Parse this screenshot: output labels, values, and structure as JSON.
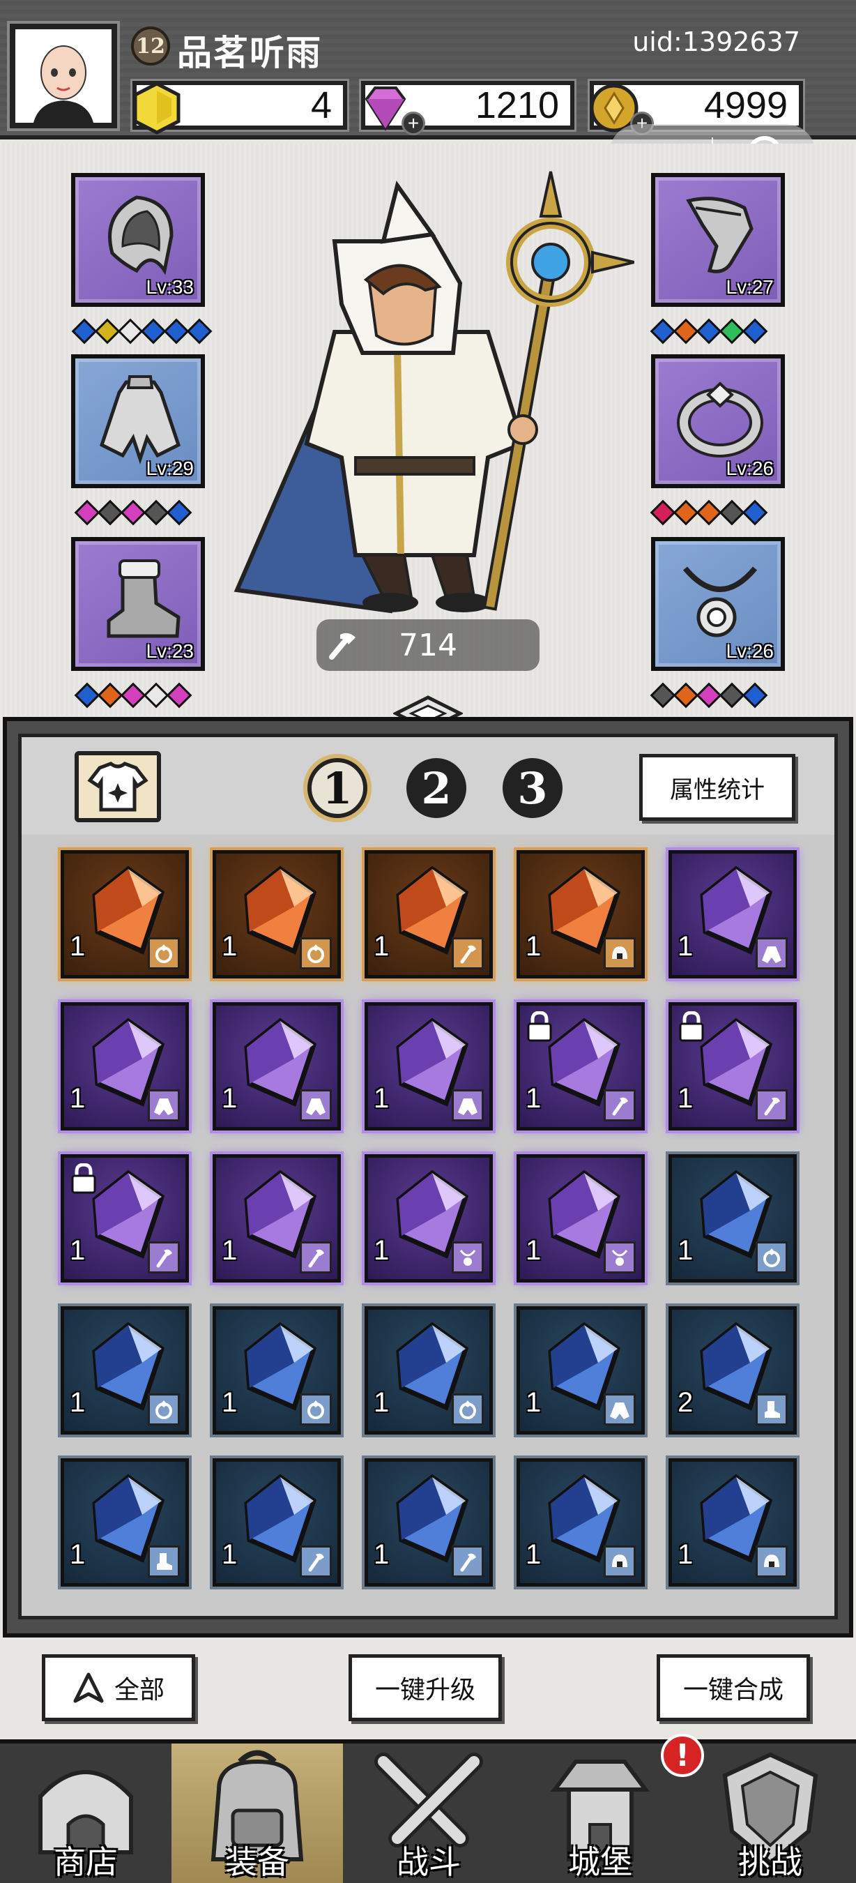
{
  "player": {
    "level": "12",
    "name": "品茗听雨",
    "uid": "uid:1392637"
  },
  "currencies": [
    {
      "name": "gold-gem",
      "value": "4"
    },
    {
      "name": "diamond",
      "value": "1210"
    },
    {
      "name": "coin",
      "value": "4999"
    }
  ],
  "hero": {
    "power": "714"
  },
  "equipment_left": [
    {
      "slot": "helmet",
      "level": "Lv:33",
      "rarity": "purple",
      "gems": [
        "#1f5fd0",
        "#d4b21a",
        "#e8e8e8",
        "#1f5fd0",
        "#1f5fd0",
        "#1f5fd0"
      ]
    },
    {
      "slot": "armor",
      "level": "Lv:29",
      "rarity": "blue",
      "gems": [
        "#d43fbe",
        "#555555",
        "#d43fbe",
        "#555555",
        "#1f5fd0"
      ]
    },
    {
      "slot": "boots",
      "level": "Lv:23",
      "rarity": "purple",
      "gems": [
        "#1f5fd0",
        "#e0651b",
        "#d43fbe",
        "#e8e8e8",
        "#d43fbe"
      ]
    }
  ],
  "equipment_right": [
    {
      "slot": "gloves",
      "level": "Lv:27",
      "rarity": "purple",
      "gems": [
        "#1f5fd0",
        "#e0651b",
        "#1f5fd0",
        "#2fbf5a",
        "#1f5fd0"
      ]
    },
    {
      "slot": "ring",
      "level": "Lv:26",
      "rarity": "purple",
      "gems": [
        "#d41f5a",
        "#e0651b",
        "#e0651b",
        "#555555",
        "#1f5fd0"
      ]
    },
    {
      "slot": "necklace",
      "level": "Lv:26",
      "rarity": "blue",
      "gems": [
        "#555555",
        "#e0651b",
        "#d43fbe",
        "#555555",
        "#1f5fd0"
      ]
    }
  ],
  "bag": {
    "tabs": [
      "1",
      "2",
      "3"
    ],
    "active_tab": "1",
    "stats_button": "属性统计",
    "items": [
      {
        "rarity": "orange",
        "count": "1",
        "type": "ring",
        "locked": false
      },
      {
        "rarity": "orange",
        "count": "1",
        "type": "ring",
        "locked": false
      },
      {
        "rarity": "orange",
        "count": "1",
        "type": "weapon",
        "locked": false
      },
      {
        "rarity": "orange",
        "count": "1",
        "type": "helmet",
        "locked": false
      },
      {
        "rarity": "purple",
        "count": "1",
        "type": "armor",
        "locked": false
      },
      {
        "rarity": "purple",
        "count": "1",
        "type": "armor",
        "locked": false
      },
      {
        "rarity": "purple",
        "count": "1",
        "type": "armor",
        "locked": false
      },
      {
        "rarity": "purple",
        "count": "1",
        "type": "armor",
        "locked": false
      },
      {
        "rarity": "purple",
        "count": "1",
        "type": "weapon",
        "locked": true
      },
      {
        "rarity": "purple",
        "count": "1",
        "type": "weapon",
        "locked": true
      },
      {
        "rarity": "purple",
        "count": "1",
        "type": "weapon",
        "locked": true
      },
      {
        "rarity": "purple",
        "count": "1",
        "type": "weapon",
        "locked": false
      },
      {
        "rarity": "purple",
        "count": "1",
        "type": "necklace",
        "locked": false
      },
      {
        "rarity": "purple",
        "count": "1",
        "type": "necklace",
        "locked": false
      },
      {
        "rarity": "blue",
        "count": "1",
        "type": "ring",
        "locked": false
      },
      {
        "rarity": "blue",
        "count": "1",
        "type": "ring",
        "locked": false
      },
      {
        "rarity": "blue",
        "count": "1",
        "type": "ring",
        "locked": false
      },
      {
        "rarity": "blue",
        "count": "1",
        "type": "ring",
        "locked": false
      },
      {
        "rarity": "blue",
        "count": "1",
        "type": "armor",
        "locked": false
      },
      {
        "rarity": "blue",
        "count": "2",
        "type": "boots",
        "locked": false
      },
      {
        "rarity": "blue",
        "count": "1",
        "type": "boots",
        "locked": false
      },
      {
        "rarity": "blue",
        "count": "1",
        "type": "weapon",
        "locked": false
      },
      {
        "rarity": "blue",
        "count": "1",
        "type": "weapon",
        "locked": false
      },
      {
        "rarity": "blue",
        "count": "1",
        "type": "helmet",
        "locked": false
      },
      {
        "rarity": "blue",
        "count": "1",
        "type": "helmet",
        "locked": false
      }
    ]
  },
  "actions": {
    "filter_all": "全部",
    "upgrade_all": "一键升级",
    "merge_all": "一键合成"
  },
  "nav": [
    {
      "id": "shop",
      "label": "商店"
    },
    {
      "id": "equip",
      "label": "装备"
    },
    {
      "id": "battle",
      "label": "战斗"
    },
    {
      "id": "castle",
      "label": "城堡"
    },
    {
      "id": "challenge",
      "label": "挑战"
    }
  ],
  "nav_active": "equip",
  "castle_alert": "!"
}
